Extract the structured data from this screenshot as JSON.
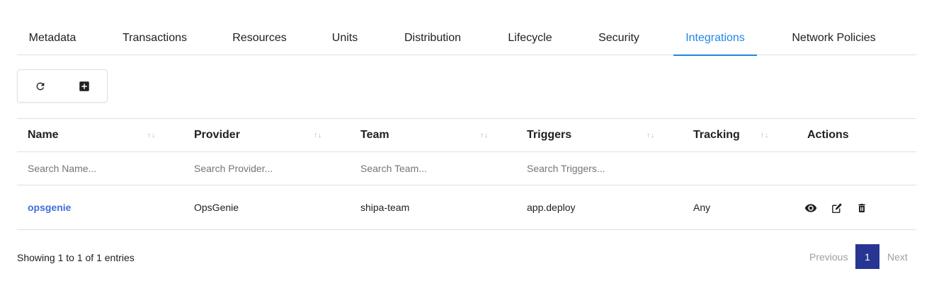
{
  "tabs": [
    {
      "label": "Metadata",
      "active": false
    },
    {
      "label": "Transactions",
      "active": false
    },
    {
      "label": "Resources",
      "active": false
    },
    {
      "label": "Units",
      "active": false
    },
    {
      "label": "Distribution",
      "active": false
    },
    {
      "label": "Lifecycle",
      "active": false
    },
    {
      "label": "Security",
      "active": false
    },
    {
      "label": "Integrations",
      "active": true
    },
    {
      "label": "Network Policies",
      "active": false
    }
  ],
  "toolbar": {
    "refresh_icon": "refresh-icon",
    "add_icon": "add-box-icon"
  },
  "table": {
    "columns": [
      "Name",
      "Provider",
      "Team",
      "Triggers",
      "Tracking",
      "Actions"
    ],
    "sort_glyph": "↑↓",
    "filters": {
      "name_placeholder": "Search Name...",
      "provider_placeholder": "Search Provider...",
      "team_placeholder": "Search Team...",
      "triggers_placeholder": "Search Triggers..."
    },
    "rows": [
      {
        "name": "opsgenie",
        "provider": "OpsGenie",
        "team": "shipa-team",
        "triggers": "app.deploy",
        "tracking": "Any",
        "actions": [
          "view-icon",
          "edit-icon",
          "delete-icon"
        ]
      }
    ]
  },
  "footer": {
    "info": "Showing 1 to 1 of 1 entries",
    "previous": "Previous",
    "current_page": "1",
    "next": "Next"
  },
  "colors": {
    "accent": "#1e88e5",
    "link": "#3f6fd9",
    "pager_active": "#283593"
  }
}
